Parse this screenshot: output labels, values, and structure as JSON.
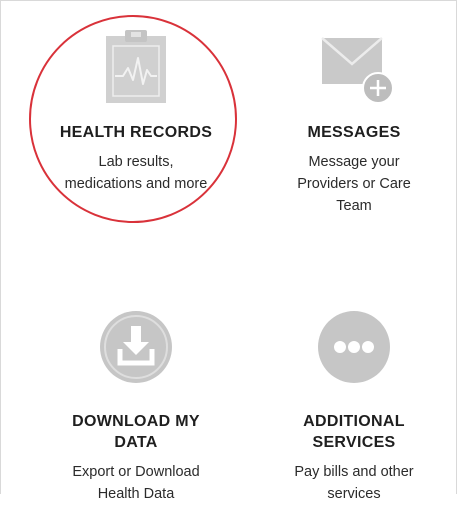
{
  "tiles": [
    {
      "icon": "clipboard-chart-icon",
      "title": "HEALTH RECORDS",
      "description": "Lab results, medications and more"
    },
    {
      "icon": "envelope-plus-icon",
      "title": "MESSAGES",
      "description": "Message your Providers or Care Team"
    },
    {
      "icon": "download-icon",
      "title": "DOWNLOAD MY DATA",
      "description": "Export or Download Health Data"
    },
    {
      "icon": "more-dots-icon",
      "title": "ADDITIONAL SERVICES",
      "description": "Pay bills and other services"
    }
  ],
  "colors": {
    "icon_gray": "#c4c4c4",
    "icon_light": "#d6d6d6",
    "highlight": "#d9323a"
  }
}
